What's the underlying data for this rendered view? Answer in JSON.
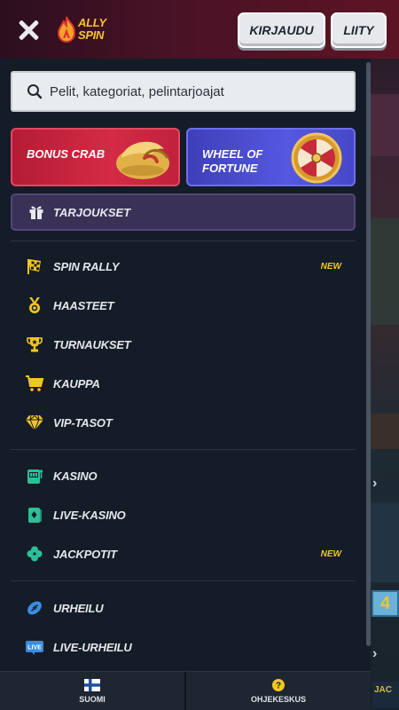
{
  "header": {
    "logo_text_line1": "ALLY",
    "logo_text_line2": "SPIN",
    "login_label": "KIRJAUDU",
    "join_label": "LIITY"
  },
  "search": {
    "placeholder": "Pelit, kategoriat, pelintarjoajat"
  },
  "promos": {
    "crab_label": "BONUS CRAB",
    "wheel_label": "WHEEL OF FORTUNE"
  },
  "offers": {
    "label": "TARJOUKSET"
  },
  "menu_group_1": [
    {
      "label": "SPIN RALLY",
      "icon": "flag-icon",
      "badge": "NEW"
    },
    {
      "label": "HAASTEET",
      "icon": "medal-icon",
      "badge": ""
    },
    {
      "label": "TURNAUKSET",
      "icon": "trophy-icon",
      "badge": ""
    },
    {
      "label": "KAUPPA",
      "icon": "cart-icon",
      "badge": ""
    },
    {
      "label": "VIP-TASOT",
      "icon": "diamond-icon",
      "badge": ""
    }
  ],
  "menu_group_2": [
    {
      "label": "KASINO",
      "icon": "slot-machine-icon",
      "badge": ""
    },
    {
      "label": "LIVE-KASINO",
      "icon": "cards-icon",
      "badge": ""
    },
    {
      "label": "JACKPOTIT",
      "icon": "clover-icon",
      "badge": "NEW"
    }
  ],
  "menu_group_3": [
    {
      "label": "URHEILU",
      "icon": "football-icon",
      "badge": ""
    },
    {
      "label": "LIVE-URHEILU",
      "icon": "live-icon",
      "badge": ""
    }
  ],
  "live_icon_text": "LIVE",
  "bottom_bar": {
    "language_label": "SUOMI",
    "help_label": "OHJEKESKUS"
  },
  "background_peek": {
    "tile_number": "4",
    "tile_text": "JAC"
  },
  "colors": {
    "accent_yellow": "#f3c623",
    "icon_teal": "#2bbf9a",
    "icon_blue": "#3a8de0",
    "panel": "#141c27"
  }
}
